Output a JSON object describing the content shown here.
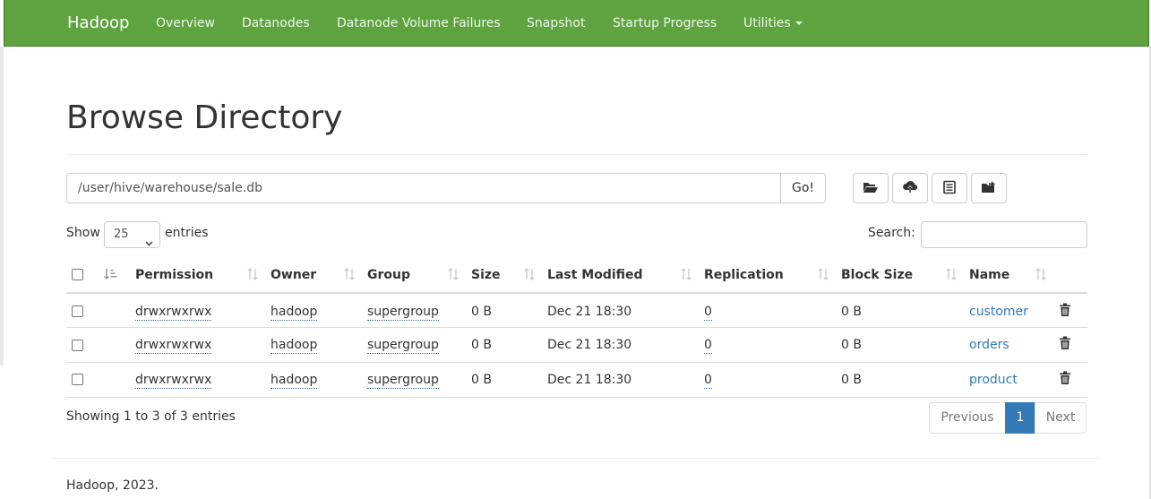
{
  "navbar": {
    "brand": "Hadoop",
    "items": [
      "Overview",
      "Datanodes",
      "Datanode Volume Failures",
      "Snapshot",
      "Startup Progress",
      "Utilities"
    ],
    "color": "#5fa341"
  },
  "page": {
    "title": "Browse Directory"
  },
  "path": {
    "value": "/user/hive/warehouse/sale.db",
    "go_label": "Go!"
  },
  "toolbar": {
    "icons": [
      "folder-open-icon",
      "cloud-upload-icon",
      "list-alt-icon",
      "folder-move-icon"
    ]
  },
  "controls": {
    "show_label": "Show",
    "length_value": "25",
    "entries_label": "entries",
    "search_label": "Search:",
    "search_value": ""
  },
  "table": {
    "columns": [
      "",
      "",
      "Permission",
      "Owner",
      "Group",
      "Size",
      "Last Modified",
      "Replication",
      "Block Size",
      "Name",
      ""
    ],
    "rows": [
      {
        "permission": "drwxrwxrwx",
        "owner": "hadoop",
        "group": "supergroup",
        "size": "0 B",
        "modified": "Dec 21 18:30",
        "replication": "0",
        "block_size": "0 B",
        "name": "customer"
      },
      {
        "permission": "drwxrwxrwx",
        "owner": "hadoop",
        "group": "supergroup",
        "size": "0 B",
        "modified": "Dec 21 18:30",
        "replication": "0",
        "block_size": "0 B",
        "name": "orders"
      },
      {
        "permission": "drwxrwxrwx",
        "owner": "hadoop",
        "group": "supergroup",
        "size": "0 B",
        "modified": "Dec 21 18:30",
        "replication": "0",
        "block_size": "0 B",
        "name": "product"
      }
    ]
  },
  "info": "Showing 1 to 3 of 3 entries",
  "pagination": {
    "previous": "Previous",
    "current": "1",
    "next": "Next",
    "active_color": "#337ab7"
  },
  "footer": "Hadoop, 2023."
}
